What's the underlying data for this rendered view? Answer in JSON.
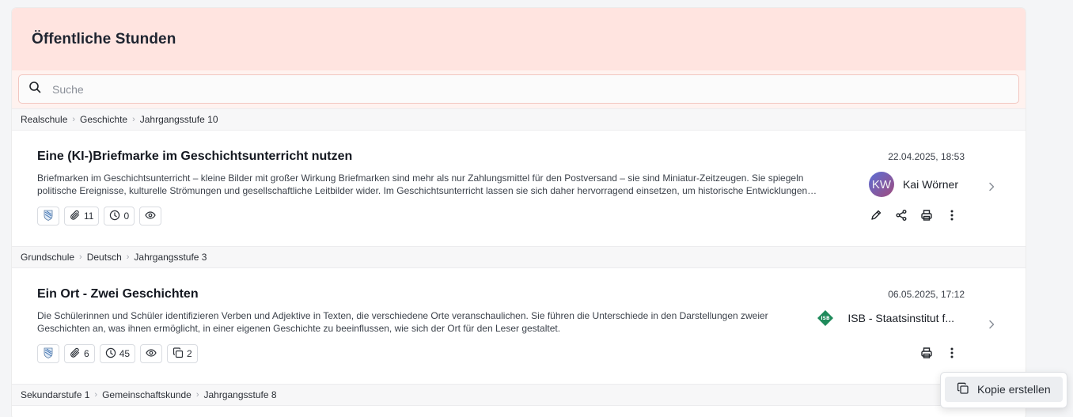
{
  "header": {
    "title": "Öffentliche Stunden"
  },
  "search": {
    "placeholder": "Suche",
    "value": ""
  },
  "lessons": [
    {
      "breadcrumb": [
        "Realschule",
        "Geschichte",
        "Jahrgangsstufe 10"
      ],
      "title": "Eine (KI-)Briefmarke im Geschichtsunterricht nutzen",
      "description": "Briefmarken im Geschichtsunterricht – kleine Bilder mit großer Wirkung Briefmarken sind mehr als nur Zahlungsmittel für den Postversand – sie sind Miniatur-Zeitzeugen. Sie spiegeln politische Ereignisse, kulturelle Strömungen und gesellschaftliche Leitbilder wider. Im Geschichtsunterricht lassen sie sich daher hervorragend einsetzen, um historische Entwicklungen anschaulich zu machen.",
      "date": "22.04.2025, 18:53",
      "author": {
        "initials": "KW",
        "name": "Kai Wörner"
      },
      "attachments": "11",
      "duration": "0"
    },
    {
      "breadcrumb": [
        "Grundschule",
        "Deutsch",
        "Jahrgangsstufe 3"
      ],
      "title": "Ein Ort - Zwei Geschichten",
      "description": "Die Schülerinnen und Schüler identifizieren Verben und Adjektive in Texten, die verschiedene Orte veranschaulichen. Sie führen die Unterschiede in den Darstellungen zweier Geschichten an, was ihnen ermöglicht, in einer eigenen Geschichte zu beeinflussen, wie sich der Ort für den Leser gestaltet.",
      "date": "06.05.2025, 17:12",
      "author": {
        "badge": "ISB",
        "name": "ISB - Staatsinstitut f..."
      },
      "attachments": "6",
      "duration": "45",
      "copies": "2"
    },
    {
      "breadcrumb": [
        "Sekundarstufe 1",
        "Gemeinschaftskunde",
        "Jahrgangsstufe 8"
      ]
    }
  ],
  "context_menu": {
    "copy_label": "Kopie erstellen"
  },
  "colors": {
    "header_bg": "#ffe4e0",
    "search_border": "#f2c6c0",
    "isb_green": "#1f8a5b"
  }
}
